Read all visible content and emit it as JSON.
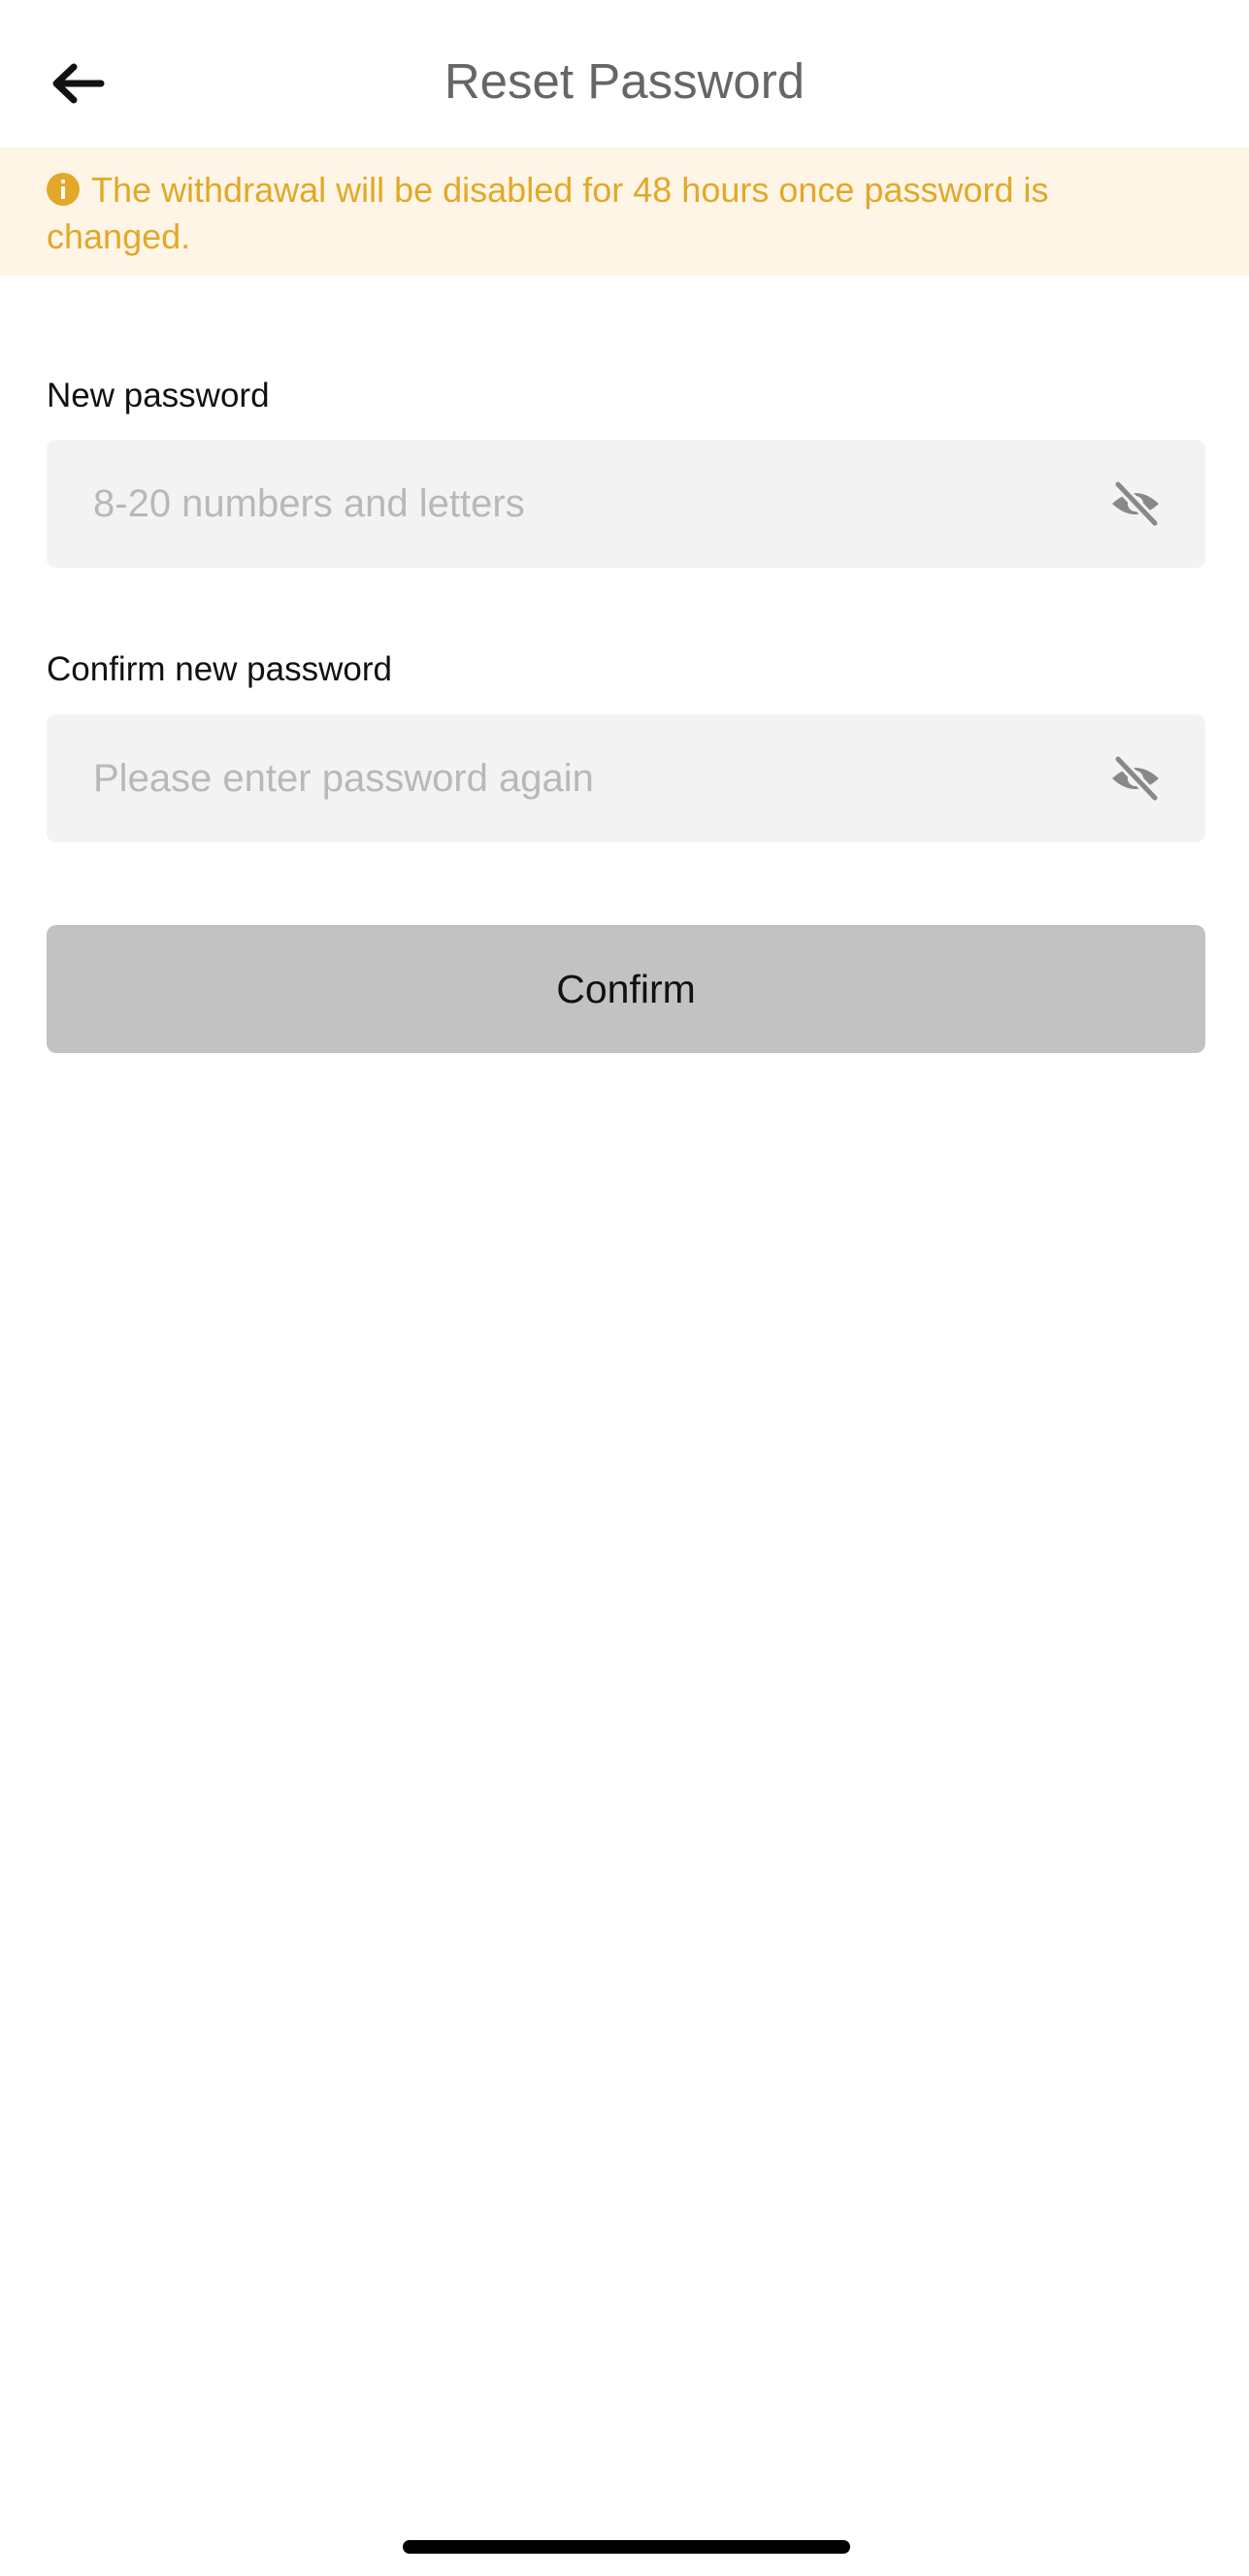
{
  "header": {
    "title": "Reset Password",
    "back_icon": "arrow-left-icon"
  },
  "banner": {
    "text": "The withdrawal will be disabled for 48 hours once password is changed.",
    "icon": "info-icon",
    "color": "#e3a827",
    "background": "#fef5e7"
  },
  "form": {
    "new_password": {
      "label": "New password",
      "placeholder": "8-20 numbers and letters",
      "value": "",
      "icon": "eye-off-icon"
    },
    "confirm_password": {
      "label": "Confirm new password",
      "placeholder": "Please enter password again",
      "value": "",
      "icon": "eye-off-icon"
    },
    "submit_label": "Confirm"
  }
}
